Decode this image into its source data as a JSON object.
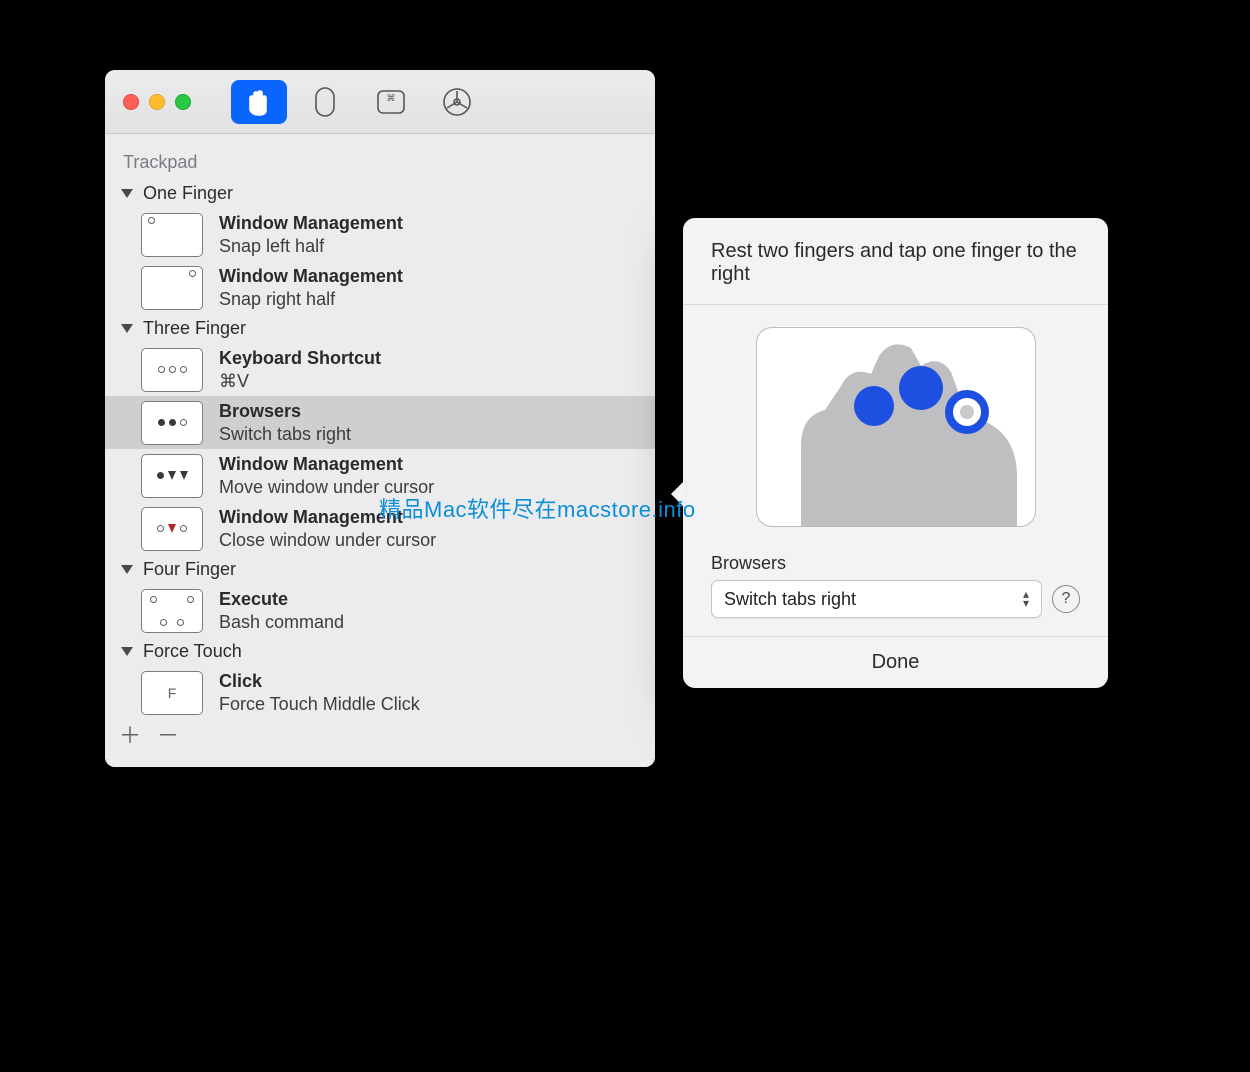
{
  "section_title": "Trackpad",
  "groups": [
    {
      "label": "One Finger",
      "rows": [
        {
          "title": "Window Management",
          "subtitle": "Snap left half"
        },
        {
          "title": "Window Management",
          "subtitle": "Snap right half"
        }
      ]
    },
    {
      "label": "Three Finger",
      "rows": [
        {
          "title": "Keyboard Shortcut",
          "subtitle": "⌘V"
        },
        {
          "title": "Browsers",
          "subtitle": "Switch tabs right",
          "selected": true
        },
        {
          "title": "Window Management",
          "subtitle": "Move window under cursor"
        },
        {
          "title": "Window Management",
          "subtitle": "Close window under cursor"
        }
      ]
    },
    {
      "label": "Four Finger",
      "rows": [
        {
          "title": "Execute",
          "subtitle": "Bash command"
        }
      ]
    },
    {
      "label": "Force Touch",
      "rows": [
        {
          "title": "Click",
          "subtitle": "Force Touch Middle Click"
        }
      ]
    }
  ],
  "popover": {
    "instruction": "Rest two fingers and tap one finger to the right",
    "category_label": "Browsers",
    "selected_action": "Switch tabs right",
    "done_label": "Done"
  },
  "watermark": "精品Mac软件尽在macstore.info"
}
